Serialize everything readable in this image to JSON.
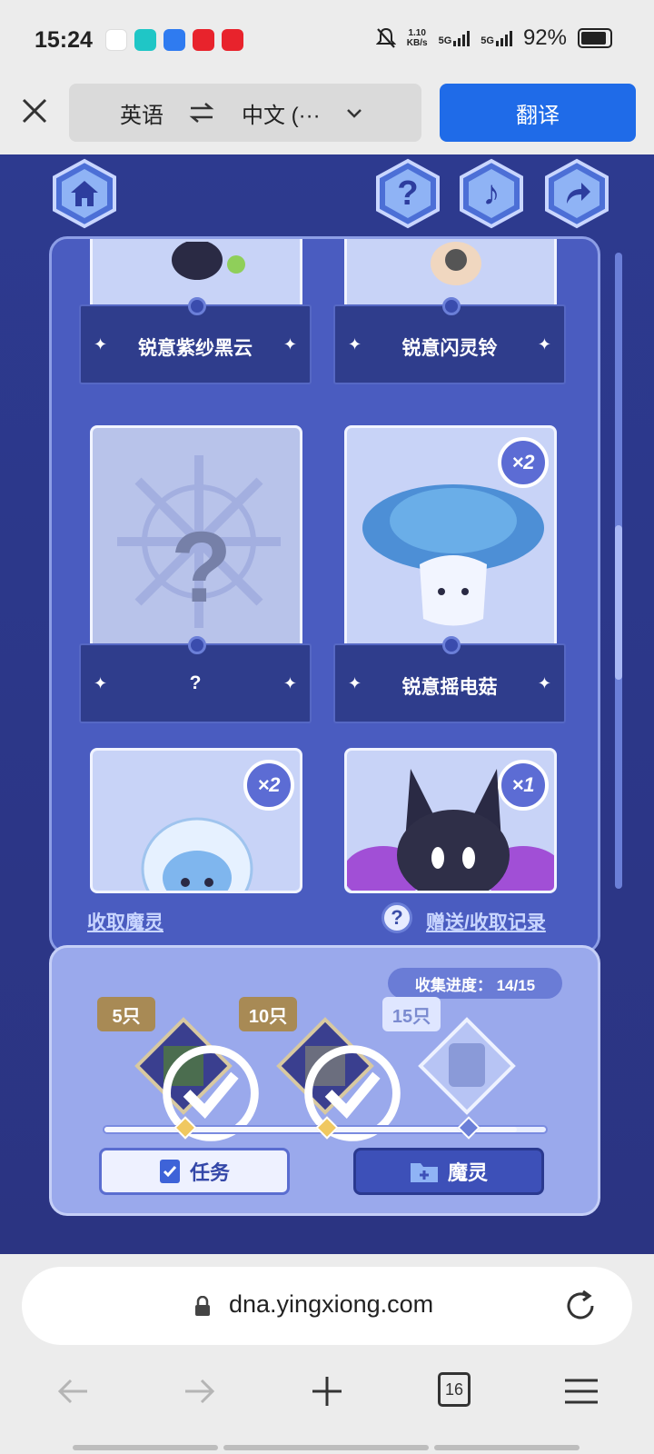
{
  "status_bar": {
    "time": "15:24",
    "net_speed": "1.10",
    "net_unit": "KB/s",
    "net1": "5G",
    "net2": "5G",
    "battery": "92%"
  },
  "translate_bar": {
    "source_lang": "英语",
    "target_lang": "中文 (···",
    "translate_btn": "翻译"
  },
  "cards": [
    {
      "name": "锐意紫纱黑云"
    },
    {
      "name": "锐意闪灵铃"
    },
    {
      "name": "?"
    },
    {
      "name": "锐意摇电菇",
      "badge": "×2"
    },
    {
      "badge": "×2"
    },
    {
      "badge": "×1"
    }
  ],
  "links": {
    "left": "收取魔灵",
    "help": "?",
    "right": "赠送/收取记录"
  },
  "progress": {
    "label": "收集进度： 14/15",
    "value": 14,
    "max": 15,
    "milestones": [
      {
        "tag": "5只",
        "claimed": true
      },
      {
        "tag": "10只",
        "claimed": true
      },
      {
        "tag": "15只",
        "claimed": false
      }
    ]
  },
  "tabs": {
    "task": "任务",
    "spirit": "魔灵"
  },
  "browser": {
    "url": "dna.yingxiong.com",
    "tab_count": "16"
  },
  "colors": {
    "translate_blue": "#1f6be8",
    "panel": "#4a5cc0",
    "panel_dark": "#2f3d8c"
  }
}
